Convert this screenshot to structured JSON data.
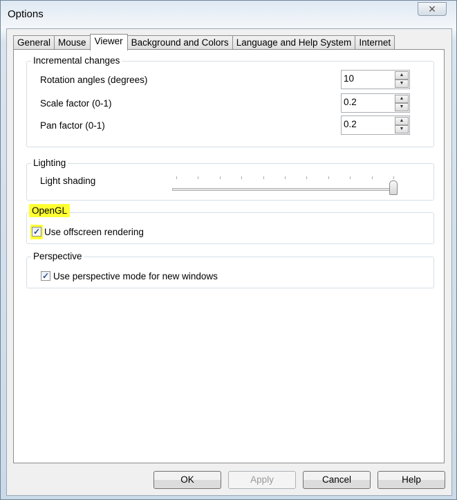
{
  "window": {
    "title": "Options",
    "close_icon": "close-icon"
  },
  "tabs": [
    {
      "label": "General"
    },
    {
      "label": "Mouse"
    },
    {
      "label": "Viewer",
      "active": true
    },
    {
      "label": "Background and Colors"
    },
    {
      "label": "Language and Help System"
    },
    {
      "label": "Internet"
    }
  ],
  "incremental": {
    "title": "Incremental changes",
    "rows": [
      {
        "label": "Rotation angles (degrees)",
        "value": "10"
      },
      {
        "label": "Scale factor (0-1)",
        "value": "0.2"
      },
      {
        "label": "Pan factor (0-1)",
        "value": "0.2"
      }
    ]
  },
  "lighting": {
    "title": "Lighting",
    "label": "Light shading",
    "slider_fraction": 1.0,
    "ticks": 11
  },
  "opengl": {
    "title": "OpenGL",
    "checkbox_label": "Use offscreen rendering",
    "checked": true,
    "highlight_color": "#ffff33"
  },
  "perspective": {
    "title": "Perspective",
    "checkbox_label": "Use perspective mode for new windows",
    "checked": true
  },
  "buttons": {
    "ok": "OK",
    "apply": "Apply",
    "cancel": "Cancel",
    "help": "Help"
  }
}
